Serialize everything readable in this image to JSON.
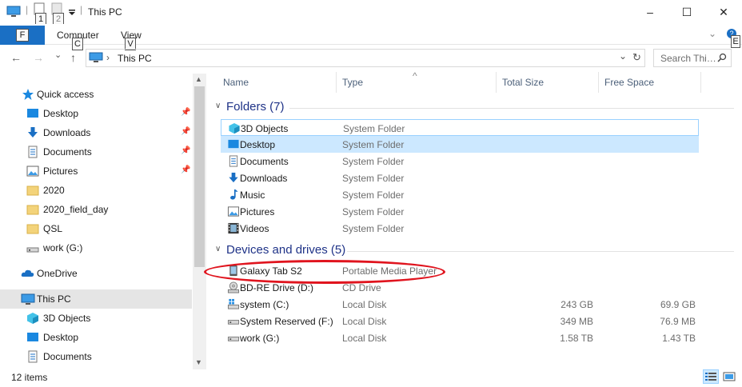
{
  "window": {
    "title": "This PC",
    "qat_keytips": [
      "1",
      "2"
    ],
    "controls": [
      "–",
      "☐",
      "✕"
    ]
  },
  "ribbon": {
    "file_keytip": "F",
    "tabs": [
      {
        "label": "Computer",
        "keytip": "C"
      },
      {
        "label": "View",
        "keytip": "V"
      }
    ],
    "help_keytip": "E",
    "help_badge": "?"
  },
  "nav": {
    "back": "←",
    "forward": "→",
    "recent": "⌄",
    "up": "↑",
    "address_chevron": "›",
    "address": "This PC",
    "address_dropdown": "⌄",
    "refresh": "↻",
    "search_placeholder": "Search Thi…"
  },
  "sidebar": {
    "items": [
      {
        "label": "Quick access",
        "icon": "star-icon",
        "pinned": false
      },
      {
        "label": "Desktop",
        "icon": "desktop-icon",
        "pinned": true
      },
      {
        "label": "Downloads",
        "icon": "download-icon",
        "pinned": true
      },
      {
        "label": "Documents",
        "icon": "document-icon",
        "pinned": true
      },
      {
        "label": "Pictures",
        "icon": "pictures-icon",
        "pinned": true
      },
      {
        "label": "2020",
        "icon": "folder-icon",
        "pinned": false
      },
      {
        "label": "2020_field_day",
        "icon": "folder-icon",
        "pinned": false
      },
      {
        "label": "QSL",
        "icon": "folder-icon",
        "pinned": false
      },
      {
        "label": "work (G:)",
        "icon": "drive-icon",
        "pinned": false
      },
      {
        "label": "OneDrive",
        "icon": "cloud-icon",
        "pinned": false
      },
      {
        "label": "This PC",
        "icon": "computer-icon",
        "pinned": false
      },
      {
        "label": "3D Objects",
        "icon": "cube-icon",
        "pinned": false
      },
      {
        "label": "Desktop",
        "icon": "desktop-icon",
        "pinned": false
      },
      {
        "label": "Documents",
        "icon": "document-icon",
        "pinned": false
      }
    ]
  },
  "columns": {
    "name": "Name",
    "type": "Type",
    "total_size": "Total Size",
    "free_space": "Free Space",
    "sort_indicator": "^"
  },
  "groups": {
    "folders": {
      "label": "Folders (7)",
      "items": [
        {
          "name": "3D Objects",
          "type": "System Folder",
          "icon": "cube-icon"
        },
        {
          "name": "Desktop",
          "type": "System Folder",
          "icon": "desktop-icon"
        },
        {
          "name": "Documents",
          "type": "System Folder",
          "icon": "document-icon"
        },
        {
          "name": "Downloads",
          "type": "System Folder",
          "icon": "download-icon"
        },
        {
          "name": "Music",
          "type": "System Folder",
          "icon": "music-icon"
        },
        {
          "name": "Pictures",
          "type": "System Folder",
          "icon": "pictures-icon"
        },
        {
          "name": "Videos",
          "type": "System Folder",
          "icon": "videos-icon"
        }
      ]
    },
    "devices": {
      "label": "Devices and drives (5)",
      "items": [
        {
          "name": "Galaxy Tab S2",
          "type": "Portable Media Player",
          "total": "",
          "free": "",
          "icon": "tablet-icon"
        },
        {
          "name": "BD-RE Drive (D:)",
          "type": "CD Drive",
          "total": "",
          "free": "",
          "icon": "disc-drive-icon"
        },
        {
          "name": "system (C:)",
          "type": "Local Disk",
          "total": "243 GB",
          "free": "69.9 GB",
          "icon": "windows-drive-icon"
        },
        {
          "name": "System Reserved (F:)",
          "type": "Local Disk",
          "total": "349 MB",
          "free": "76.9 MB",
          "icon": "drive-icon"
        },
        {
          "name": "work (G:)",
          "type": "Local Disk",
          "total": "1.58 TB",
          "free": "1.43 TB",
          "icon": "drive-icon"
        }
      ]
    }
  },
  "status": {
    "item_count": "12 items"
  },
  "colors": {
    "accent": "#1a6fc4",
    "selection": "#cce8ff",
    "hover_border": "#99d1ff",
    "annotation": "#e0141e"
  }
}
